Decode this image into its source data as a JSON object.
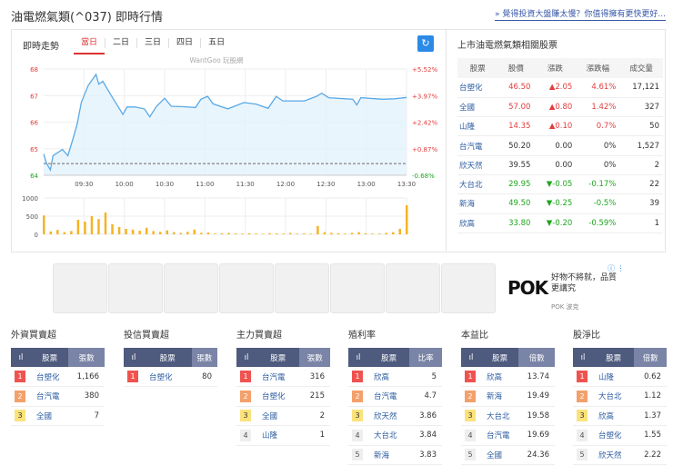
{
  "header": {
    "title": "油電燃氣類(^037) 即時行情",
    "promo_link": "» 覺得投資大盤賺太慢？你值得擁有更快更好..."
  },
  "chart": {
    "title": "即時走勢",
    "tabs": [
      "當日",
      "二日",
      "三日",
      "四日",
      "五日"
    ],
    "active_tab": "當日",
    "watermark": "WantGoo 玩股網",
    "refresh_icon": "refresh-icon"
  },
  "chart_data": {
    "type": "line",
    "price_ticks": [
      "68",
      "67",
      "66",
      "65",
      "64"
    ],
    "pct_ticks": [
      "+5.52%",
      "+3.97%",
      "+2.42%",
      "+0.87%",
      "-0.68%"
    ],
    "x_ticks": [
      "09:30",
      "10:00",
      "10:30",
      "11:00",
      "11:30",
      "12:00",
      "12:30",
      "13:00",
      "13:30"
    ],
    "vol_ticks": [
      "1000",
      "500",
      "0"
    ],
    "ylim": [
      64,
      68
    ],
    "prev_close": 64.44,
    "xlim_minutes": [
      0,
      270
    ],
    "price": [
      [
        0,
        64.8
      ],
      [
        2,
        64.46
      ],
      [
        5,
        64.2
      ],
      [
        7,
        64.74
      ],
      [
        14,
        64.97
      ],
      [
        18,
        64.74
      ],
      [
        22,
        65.4
      ],
      [
        25,
        65.94
      ],
      [
        28,
        66.74
      ],
      [
        33,
        67.37
      ],
      [
        39,
        67.8
      ],
      [
        41,
        67.43
      ],
      [
        44,
        67.54
      ],
      [
        48,
        67.2
      ],
      [
        52,
        66.86
      ],
      [
        59,
        66.29
      ],
      [
        62,
        66.57
      ],
      [
        68,
        66.57
      ],
      [
        75,
        66.5
      ],
      [
        79,
        66.2
      ],
      [
        84,
        66.6
      ],
      [
        90,
        66.9
      ],
      [
        95,
        66.6
      ],
      [
        104,
        66.58
      ],
      [
        113,
        66.55
      ],
      [
        117,
        66.86
      ],
      [
        122,
        66.97
      ],
      [
        126,
        66.69
      ],
      [
        137,
        66.5
      ],
      [
        142,
        66.6
      ],
      [
        149,
        66.74
      ],
      [
        158,
        66.68
      ],
      [
        167,
        66.52
      ],
      [
        173,
        66.97
      ],
      [
        178,
        66.8
      ],
      [
        194,
        66.8
      ],
      [
        203,
        66.97
      ],
      [
        207,
        67.09
      ],
      [
        212,
        66.92
      ],
      [
        230,
        66.86
      ],
      [
        233,
        66.65
      ],
      [
        236,
        66.92
      ],
      [
        252,
        66.86
      ],
      [
        261,
        66.88
      ],
      [
        270,
        66.93
      ]
    ],
    "volume": [
      520,
      80,
      120,
      60,
      90,
      400,
      350,
      500,
      420,
      600,
      280,
      200,
      150,
      130,
      100,
      180,
      90,
      70,
      110,
      60,
      40,
      70,
      130,
      40,
      50,
      20,
      30,
      40,
      25,
      20,
      30,
      20,
      15,
      30,
      25,
      20,
      40,
      20,
      25,
      20,
      230,
      60,
      40,
      30,
      20,
      40,
      60,
      30,
      20,
      20,
      40,
      60,
      150,
      800
    ]
  },
  "related": {
    "title": "上市油電燃氣類相關股票",
    "columns": [
      "股票",
      "股價",
      "漲跌",
      "漲跌幅",
      "成交量"
    ],
    "rows": [
      {
        "name": "台塑化",
        "price": "46.50",
        "chg": "▲2.05",
        "pct": "4.61%",
        "vol": "17,121",
        "dir": "up"
      },
      {
        "name": "全國",
        "price": "57.00",
        "chg": "▲0.80",
        "pct": "1.42%",
        "vol": "327",
        "dir": "up"
      },
      {
        "name": "山隆",
        "price": "14.35",
        "chg": "▲0.10",
        "pct": "0.7%",
        "vol": "50",
        "dir": "up"
      },
      {
        "name": "台汽電",
        "price": "50.20",
        "chg": "0.00",
        "pct": "0%",
        "vol": "1,527",
        "dir": "flat"
      },
      {
        "name": "欣天然",
        "price": "39.55",
        "chg": "0.00",
        "pct": "0%",
        "vol": "2",
        "dir": "flat"
      },
      {
        "name": "大台北",
        "price": "29.95",
        "chg": "▼-0.05",
        "pct": "-0.17%",
        "vol": "22",
        "dir": "dn"
      },
      {
        "name": "新海",
        "price": "49.50",
        "chg": "▼-0.25",
        "pct": "-0.5%",
        "vol": "39",
        "dir": "dn"
      },
      {
        "name": "欣高",
        "price": "33.80",
        "chg": "▼-0.20",
        "pct": "-0.59%",
        "vol": "1",
        "dir": "dn"
      }
    ]
  },
  "ad": {
    "brand_logo": "POK",
    "text": "好物不將就，品質更講究",
    "source": "POK 波克"
  },
  "rankings": [
    {
      "title": "外資買賣超",
      "cols": [
        "股票",
        "張數"
      ],
      "rows": [
        [
          "台塑化",
          "1,166"
        ],
        [
          "台汽電",
          "380"
        ],
        [
          "全國",
          "7"
        ]
      ]
    },
    {
      "title": "投信買賣超",
      "cols": [
        "股票",
        "張數"
      ],
      "rows": [
        [
          "台塑化",
          "80"
        ]
      ]
    },
    {
      "title": "主力買賣超",
      "cols": [
        "股票",
        "張數"
      ],
      "rows": [
        [
          "台汽電",
          "316"
        ],
        [
          "台塑化",
          "215"
        ],
        [
          "全國",
          "2"
        ],
        [
          "山隆",
          "1"
        ]
      ]
    },
    {
      "title": "殖利率",
      "cols": [
        "股票",
        "比率"
      ],
      "rows": [
        [
          "欣高",
          "5"
        ],
        [
          "台汽電",
          "4.7"
        ],
        [
          "欣天然",
          "3.86"
        ],
        [
          "大台北",
          "3.84"
        ],
        [
          "新海",
          "3.83"
        ]
      ]
    },
    {
      "title": "本益比",
      "cols": [
        "股票",
        "倍數"
      ],
      "rows": [
        [
          "欣高",
          "13.74"
        ],
        [
          "新海",
          "19.49"
        ],
        [
          "大台北",
          "19.58"
        ],
        [
          "台汽電",
          "19.69"
        ],
        [
          "全國",
          "24.36"
        ]
      ]
    },
    {
      "title": "股淨比",
      "cols": [
        "股票",
        "倍數"
      ],
      "rows": [
        [
          "山隆",
          "0.62"
        ],
        [
          "大台北",
          "1.12"
        ],
        [
          "欣高",
          "1.37"
        ],
        [
          "台塑化",
          "1.55"
        ],
        [
          "欣天然",
          "2.22"
        ]
      ]
    }
  ]
}
